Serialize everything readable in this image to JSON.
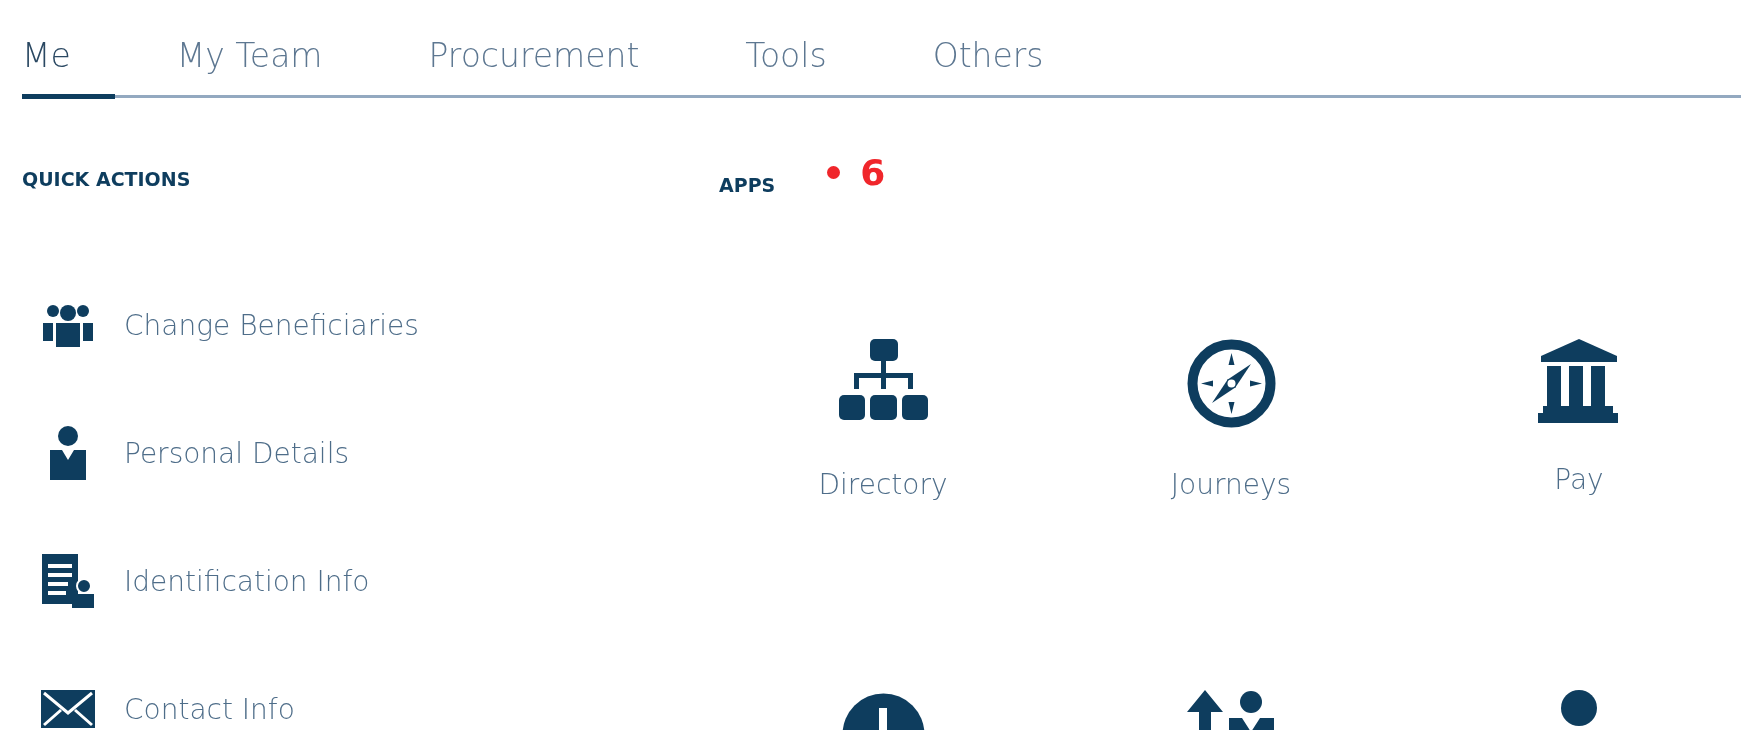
{
  "tabs": [
    {
      "label": "Me",
      "selected": true
    },
    {
      "label": "My Team",
      "selected": false
    },
    {
      "label": "Procurement",
      "selected": false
    },
    {
      "label": "Tools",
      "selected": false
    },
    {
      "label": "Others",
      "selected": false
    }
  ],
  "quick_actions": {
    "title": "QUICK ACTIONS",
    "items": [
      {
        "label": "Change Beneficiaries"
      },
      {
        "label": "Personal Details"
      },
      {
        "label": "Identification Info"
      },
      {
        "label": "Contact Info"
      }
    ]
  },
  "apps": {
    "title": "APPS",
    "annotation": {
      "label": "6",
      "color": "#f0262b"
    },
    "items": [
      {
        "kind": "labeled",
        "label": "Directory"
      },
      {
        "kind": "labeled",
        "label": "Journeys"
      },
      {
        "kind": "labeled",
        "label": "Pay"
      },
      {
        "kind": "icon_only"
      },
      {
        "kind": "icon_only"
      },
      {
        "kind": "icon_only"
      }
    ]
  }
}
